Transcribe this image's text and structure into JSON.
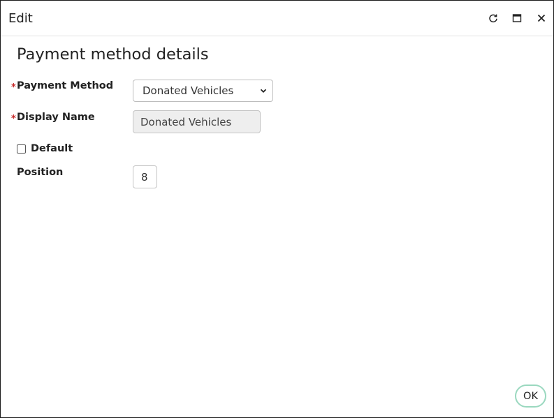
{
  "window": {
    "title": "Edit",
    "controls": {
      "refresh_icon": "refresh-icon",
      "maximize_icon": "maximize-icon",
      "close_icon": "close-icon"
    }
  },
  "form": {
    "heading": "Payment method details",
    "required_marker": "*",
    "payment_method": {
      "label": "Payment Method",
      "value": "Donated Vehicles"
    },
    "display_name": {
      "label": "Display Name",
      "value": "Donated Vehicles"
    },
    "default": {
      "label": "Default",
      "checked": false
    },
    "position": {
      "label": "Position",
      "value": "8"
    }
  },
  "footer": {
    "ok_label": "OK"
  },
  "colors": {
    "required": "#c62828",
    "ok_border": "#9ad8bf",
    "readonly_bg": "#eeeeee"
  }
}
